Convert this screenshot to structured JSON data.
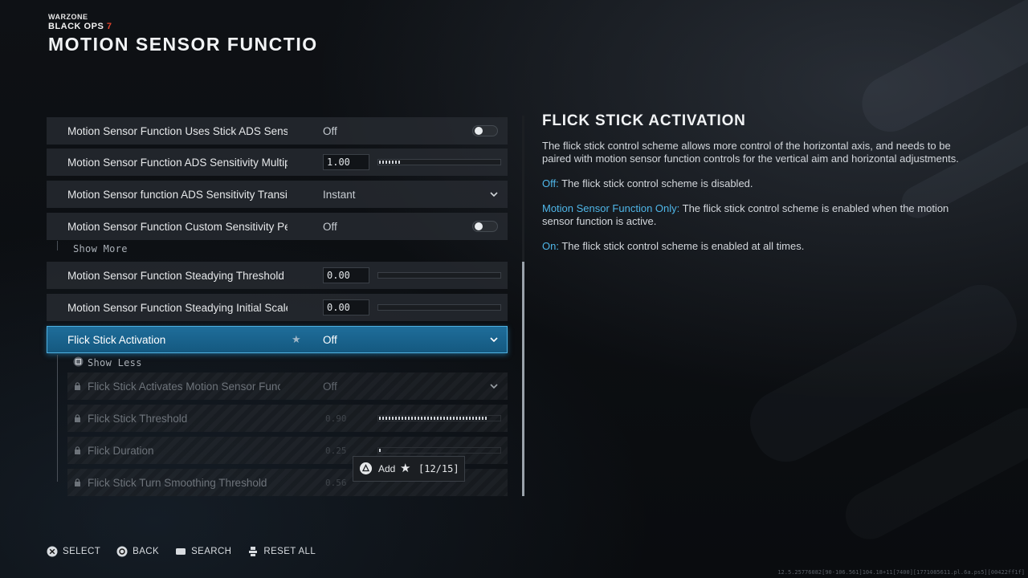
{
  "brand": {
    "top": "WARZONE",
    "game": "BLACK OPS",
    "game_num": "7"
  },
  "page_title": "MOTION SENSOR FUNCTION A",
  "settings": {
    "rows": [
      {
        "label": "Motion Sensor Function Uses Stick ADS Sensitivity",
        "value": "Off"
      },
      {
        "label": "Motion Sensor Function ADS Sensitivity Multiplier",
        "value": "1.00",
        "slider_fraction": 0.18
      },
      {
        "label": "Motion Sensor function ADS Sensitivity Transition Ti",
        "value": "Instant"
      },
      {
        "label": "Motion Sensor Function Custom Sensitivity Per Zoor",
        "value": "Off"
      },
      {
        "label": "Motion Sensor Function Steadying Threshold",
        "value": "0.00",
        "slider_fraction": 0
      },
      {
        "label": "Motion Sensor Function Steadying Initial Scale",
        "value": "0.00",
        "slider_fraction": 0
      },
      {
        "label": "Flick Stick Activation",
        "value": "Off"
      },
      {
        "label": "Flick Stick Activates Motion Sensor Function",
        "value": "Off"
      },
      {
        "label": "Flick Stick Threshold",
        "value": "0.90",
        "slider_fraction": 0.9
      },
      {
        "label": "Flick Duration",
        "value": "0.25",
        "slider_fraction": 0.02
      },
      {
        "label": "Flick Stick Turn Smoothing Threshold",
        "value": "0.56",
        "slider_fraction": 0.0
      }
    ],
    "show_more": "Show More",
    "show_less": "Show Less"
  },
  "detail": {
    "title": "FLICK STICK ACTIVATION",
    "description": "The flick stick control scheme allows more control of the horizontal axis, and needs to be paired with motion sensor function controls for the vertical aim and horizontal adjustments.",
    "options": [
      {
        "name": "Off:",
        "text": " The flick stick control scheme is disabled."
      },
      {
        "name": "Motion Sensor Function Only:",
        "text": " The flick stick control scheme is enabled when the motion sensor function is active."
      },
      {
        "name": "On:",
        "text": " The flick stick control scheme is enabled at all times."
      }
    ]
  },
  "tooltip": {
    "action": "Add",
    "count": "[12/15]"
  },
  "footer": {
    "select": "SELECT",
    "back": "BACK",
    "search": "SEARCH",
    "reset_all": "RESET ALL"
  },
  "build_info": "12.5.25776082[90-106.561]104.18+11[7400][1771085611.pl.6a.ps5][00422ff1f]",
  "colors": {
    "accent": "#4fb6e8",
    "selected_row": "#1f6e9b"
  }
}
